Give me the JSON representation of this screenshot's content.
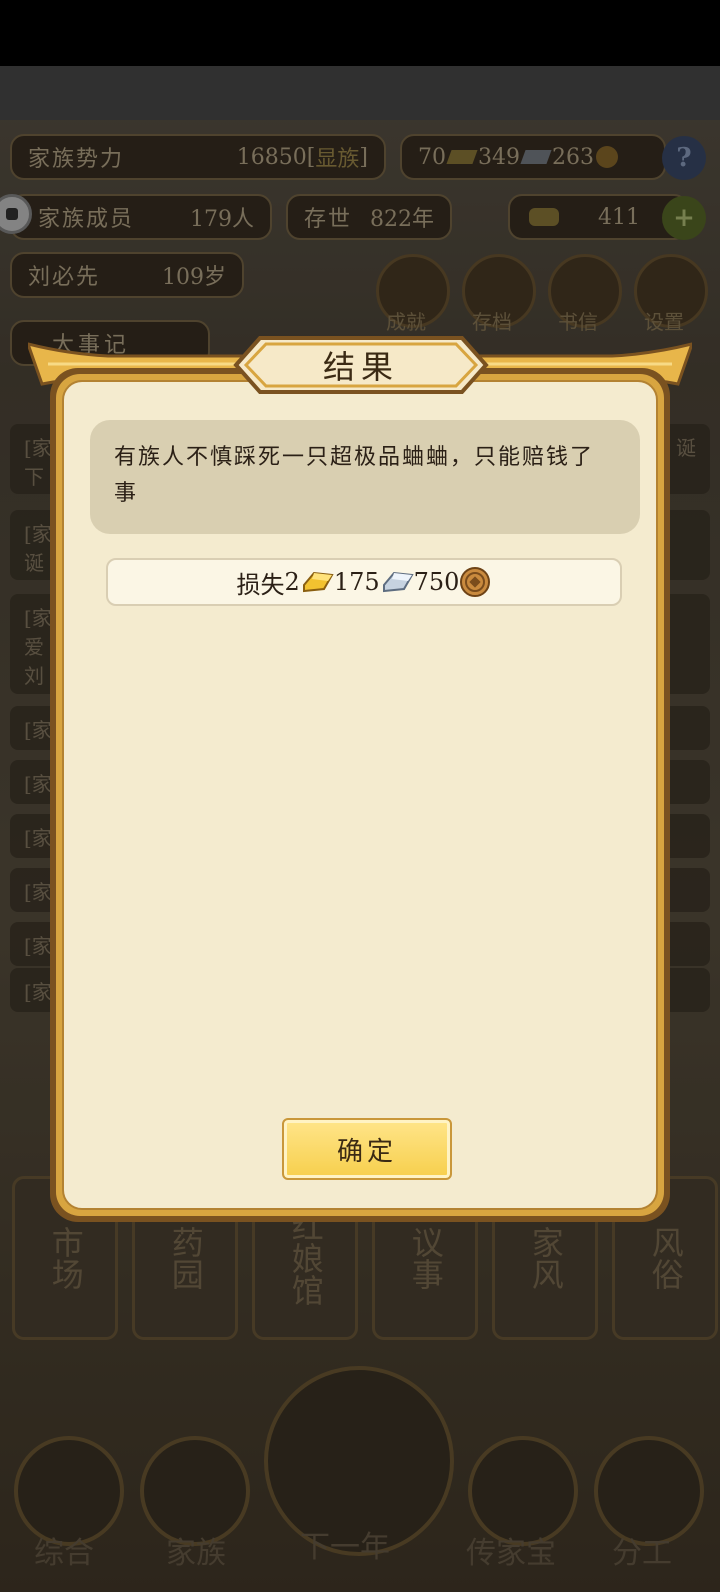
{
  "stats": {
    "clan_power_label": "家族势力",
    "clan_power_value": "16850",
    "clan_rank_prefix": "[",
    "clan_rank": "显族",
    "clan_rank_suffix": "]",
    "gold": "70",
    "silver": "349",
    "copper": "263",
    "help_label": "?",
    "members_label": "家族成员",
    "members_value": "179人",
    "exist_label": "存世",
    "exist_value": "822年",
    "yuanbao": "411",
    "add_label": "+",
    "patriarch_name": "刘必先",
    "patriarch_age": "109岁"
  },
  "menu_icons": [
    {
      "label": "成就"
    },
    {
      "label": "存档"
    },
    {
      "label": "书信"
    },
    {
      "label": "设置"
    }
  ],
  "log": {
    "title": "大事记",
    "rows": [
      "[家",
      "[家",
      "[家",
      "[家",
      "[家",
      "[家",
      "[家",
      "[家",
      "[家"
    ],
    "fragment_1": "下",
    "fragment_2": "诞",
    "fragment_3": "爱",
    "fragment_4": "刘",
    "right_fragment": "诞"
  },
  "buildings": [
    "市场",
    "药园",
    "红娘馆",
    "议事",
    "家风",
    "风俗"
  ],
  "nav": [
    {
      "label": "综合"
    },
    {
      "label": "家族"
    },
    {
      "label": "下一年"
    },
    {
      "label": "传家宝"
    },
    {
      "label": "分工"
    }
  ],
  "dialog": {
    "title": "结果",
    "message": "有族人不慎踩死一只超极品蛐蛐，只能赔钱了事",
    "loss_label": "损失",
    "loss_gold": "2",
    "loss_silver": "175",
    "loss_copper": "750",
    "confirm_label": "确定"
  },
  "colors": {
    "dialog_bg": "#f4ebcf",
    "dialog_frame": "#d8a540",
    "confirm_bg": "#f7cf4c"
  }
}
